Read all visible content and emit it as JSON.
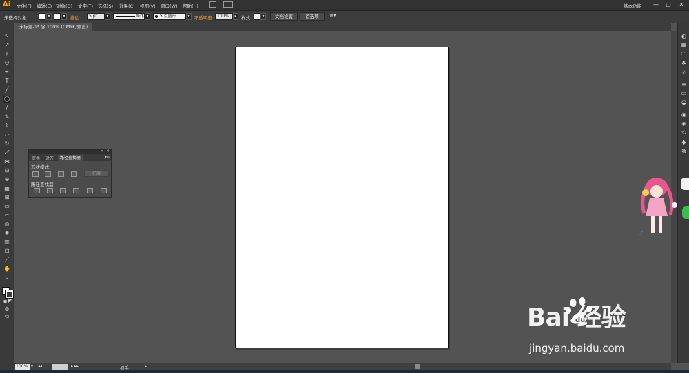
{
  "app": {
    "logo": "Ai",
    "workspace": "基本功能",
    "window_buttons": [
      "—",
      "□",
      "✕"
    ]
  },
  "menu": [
    "文件(F)",
    "编辑(E)",
    "对象(O)",
    "文字(T)",
    "选择(S)",
    "效果(C)",
    "视图(V)",
    "窗口(W)",
    "帮助(H)"
  ],
  "control_bar": {
    "no_selection": "未选择对象",
    "stroke_label": "描边:",
    "stroke_weight": "5 pt",
    "stroke_profile": "等比",
    "brush": "5 点圆形",
    "opacity_label": "不透明度:",
    "opacity_value": "100%",
    "style_label": "样式:",
    "doc_setup": "文档设置",
    "preferences": "首选项"
  },
  "document_tab": "未标题-1* @ 100% (CMYK/预览)",
  "pathfinder_panel": {
    "tabs": [
      "变换",
      "对齐",
      "路径查找器"
    ],
    "active_tab": "路径查找器",
    "shape_modes_label": "形状模式:",
    "expand_button": "扩展",
    "pathfinders_label": "路径查找器:"
  },
  "status_bar": {
    "zoom": "100%",
    "status": "抓手"
  },
  "watermark": {
    "brand": "Bai 经验",
    "url": "jingyan.baidu.com"
  },
  "colors": {
    "accent": "#ff9a00",
    "canvas": "#535353",
    "link": "#e8a13a"
  }
}
